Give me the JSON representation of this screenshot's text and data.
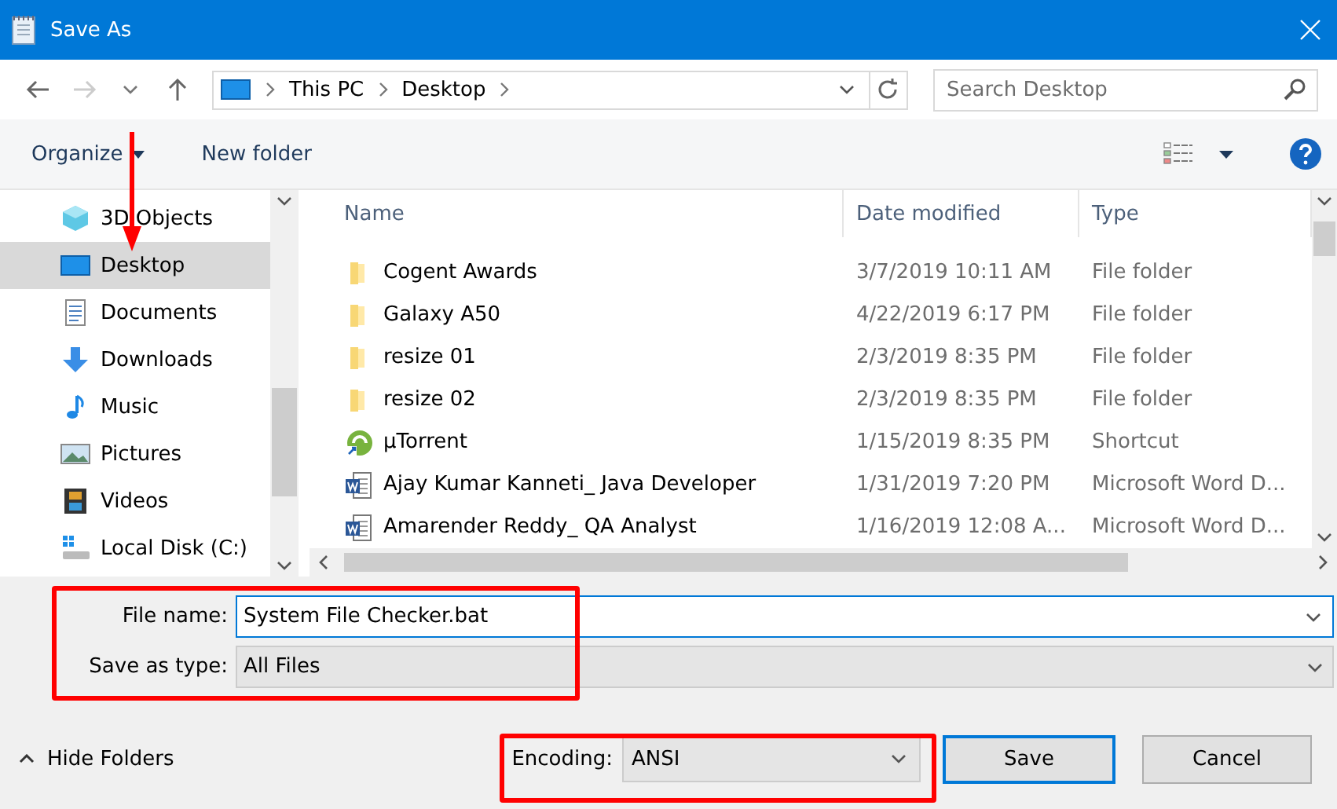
{
  "window": {
    "title": "Save As"
  },
  "address": {
    "crumbs": [
      "This PC",
      "Desktop"
    ]
  },
  "search": {
    "placeholder": "Search Desktop"
  },
  "toolbar": {
    "organize": "Organize",
    "new_folder": "New folder"
  },
  "sidebar": {
    "items": [
      {
        "label": "3D Objects",
        "kind": "cube",
        "selected": false
      },
      {
        "label": "Desktop",
        "kind": "desktop",
        "selected": true
      },
      {
        "label": "Documents",
        "kind": "documents",
        "selected": false
      },
      {
        "label": "Downloads",
        "kind": "downloads",
        "selected": false
      },
      {
        "label": "Music",
        "kind": "music",
        "selected": false
      },
      {
        "label": "Pictures",
        "kind": "pictures",
        "selected": false
      },
      {
        "label": "Videos",
        "kind": "videos",
        "selected": false
      },
      {
        "label": "Local Disk (C:)",
        "kind": "disk",
        "selected": false
      }
    ]
  },
  "table": {
    "columns": [
      "Name",
      "Date modified",
      "Type"
    ],
    "rows": [
      {
        "kind": "folder",
        "name": "Cogent Awards",
        "date": "3/7/2019 10:11 AM",
        "type": "File folder"
      },
      {
        "kind": "folder",
        "name": "Galaxy A50",
        "date": "4/22/2019 6:17 PM",
        "type": "File folder"
      },
      {
        "kind": "folder",
        "name": "resize 01",
        "date": "2/3/2019 8:35 PM",
        "type": "File folder"
      },
      {
        "kind": "folder",
        "name": "resize 02",
        "date": "2/3/2019 8:35 PM",
        "type": "File folder"
      },
      {
        "kind": "shortcut",
        "name": "µTorrent",
        "date": "1/15/2019 8:35 PM",
        "type": "Shortcut"
      },
      {
        "kind": "word",
        "name": "Ajay Kumar Kanneti_ Java Developer",
        "date": "1/31/2019 7:20 PM",
        "type": "Microsoft Word D..."
      },
      {
        "kind": "word",
        "name": "Amarender Reddy_ QA Analyst",
        "date": "1/16/2019 12:08 A...",
        "type": "Microsoft Word D..."
      }
    ]
  },
  "form": {
    "file_name_label": "File name:",
    "file_name": "System File Checker.bat",
    "type_label": "Save as type:",
    "type": "All Files"
  },
  "footer": {
    "hide_folders": "Hide Folders",
    "encoding_label": "Encoding:",
    "encoding": "ANSI",
    "save": "Save",
    "cancel": "Cancel"
  }
}
